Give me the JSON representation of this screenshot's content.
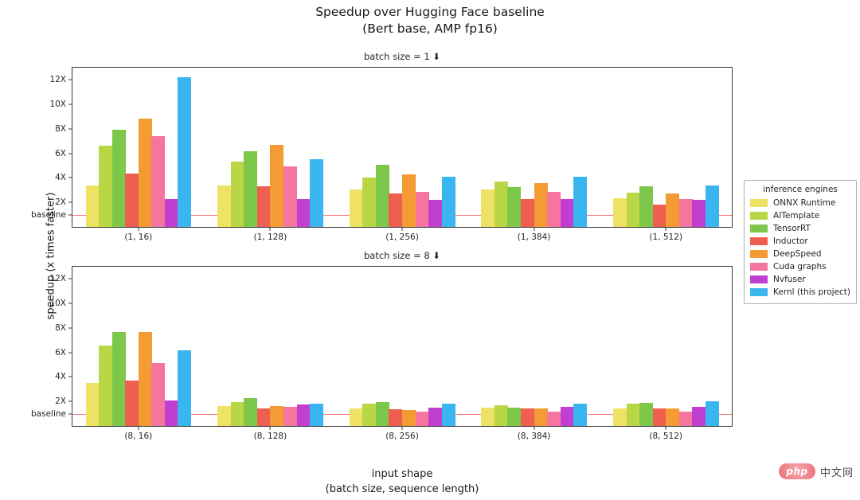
{
  "title": "Speedup over Hugging Face baseline\n(Bert base, AMP fp16)",
  "xlabel": "input shape\n(batch size, sequence length)",
  "ylabel": "speedup (x times faster)",
  "legend": {
    "title": "inference engines",
    "entries": [
      {
        "label": "ONNX Runtime",
        "color": "#eee264"
      },
      {
        "label": "AITemplate",
        "color": "#b9d745"
      },
      {
        "label": "TensorRT",
        "color": "#7dc74a"
      },
      {
        "label": "Inductor",
        "color": "#ee5f4f"
      },
      {
        "label": "DeepSpeed",
        "color": "#f49b33"
      },
      {
        "label": "Cuda graphs",
        "color": "#f5759e"
      },
      {
        "label": "Nvfuser",
        "color": "#c13fd0"
      },
      {
        "label": "Kernl (this project)",
        "color": "#39b5ef"
      }
    ]
  },
  "watermark": {
    "badge": "php",
    "text": "中文网"
  },
  "chart_data": {
    "type": "bar",
    "title": "Speedup over Hugging Face baseline (Bert base, AMP fp16)",
    "xlabel": "input shape (batch size, sequence length)",
    "ylabel": "speedup (x times faster)",
    "ylim": [
      0,
      13
    ],
    "yticks": [
      1,
      2,
      4,
      6,
      8,
      10,
      12
    ],
    "ytick_labels": [
      "baseline",
      "2X",
      "4X",
      "6X",
      "8X",
      "10X",
      "12X"
    ],
    "grid": false,
    "legend_position": "right",
    "baseline_value": 1,
    "baseline_color": "#ff5f5f",
    "series_names": [
      "ONNX Runtime",
      "AITemplate",
      "TensorRT",
      "Inductor",
      "DeepSpeed",
      "Cuda graphs",
      "Nvfuser",
      "Kernl (this project)"
    ],
    "subplots": [
      {
        "title": "batch size = 1 ⬇",
        "categories": [
          "(1, 16)",
          "(1, 128)",
          "(1, 256)",
          "(1, 384)",
          "(1, 512)"
        ],
        "series": [
          {
            "name": "ONNX Runtime",
            "values": [
              3.4,
              3.35,
              3.05,
              3.05,
              2.35
            ]
          },
          {
            "name": "AITemplate",
            "values": [
              6.6,
              5.35,
              4.05,
              3.7,
              2.8
            ]
          },
          {
            "name": "TensorRT",
            "values": [
              7.95,
              6.2,
              5.1,
              3.25,
              3.3
            ]
          },
          {
            "name": "Inductor",
            "values": [
              4.35,
              3.3,
              2.75,
              2.25,
              1.85
            ]
          },
          {
            "name": "DeepSpeed",
            "values": [
              8.85,
              6.7,
              4.3,
              3.6,
              2.7
            ]
          },
          {
            "name": "Cuda graphs",
            "values": [
              7.4,
              4.95,
              2.85,
              2.85,
              2.3
            ]
          },
          {
            "name": "Nvfuser",
            "values": [
              2.25,
              2.25,
              2.2,
              2.25,
              2.2
            ]
          },
          {
            "name": "Kernl (this project)",
            "values": [
              12.25,
              5.5,
              4.1,
              4.1,
              3.35
            ]
          }
        ]
      },
      {
        "title": "batch size = 8 ⬇",
        "categories": [
          "(8, 16)",
          "(8, 128)",
          "(8, 256)",
          "(8, 384)",
          "(8, 512)"
        ],
        "series": [
          {
            "name": "ONNX Runtime",
            "values": [
              3.5,
              1.6,
              1.4,
              1.5,
              1.45
            ]
          },
          {
            "name": "AITemplate",
            "values": [
              6.55,
              1.95,
              1.8,
              1.7,
              1.8
            ]
          },
          {
            "name": "TensorRT",
            "values": [
              7.7,
              2.25,
              1.95,
              1.5,
              1.9
            ]
          },
          {
            "name": "Inductor",
            "values": [
              3.7,
              1.45,
              1.35,
              1.4,
              1.45
            ]
          },
          {
            "name": "DeepSpeed",
            "values": [
              7.7,
              1.65,
              1.3,
              1.4,
              1.4
            ]
          },
          {
            "name": "Cuda graphs",
            "values": [
              5.15,
              1.55,
              1.2,
              1.15,
              1.2
            ]
          },
          {
            "name": "Nvfuser",
            "values": [
              2.1,
              1.75,
              1.5,
              1.55,
              1.55
            ]
          },
          {
            "name": "Kernl (this project)",
            "values": [
              6.2,
              1.85,
              1.85,
              1.8,
              2.0
            ]
          }
        ]
      }
    ]
  }
}
